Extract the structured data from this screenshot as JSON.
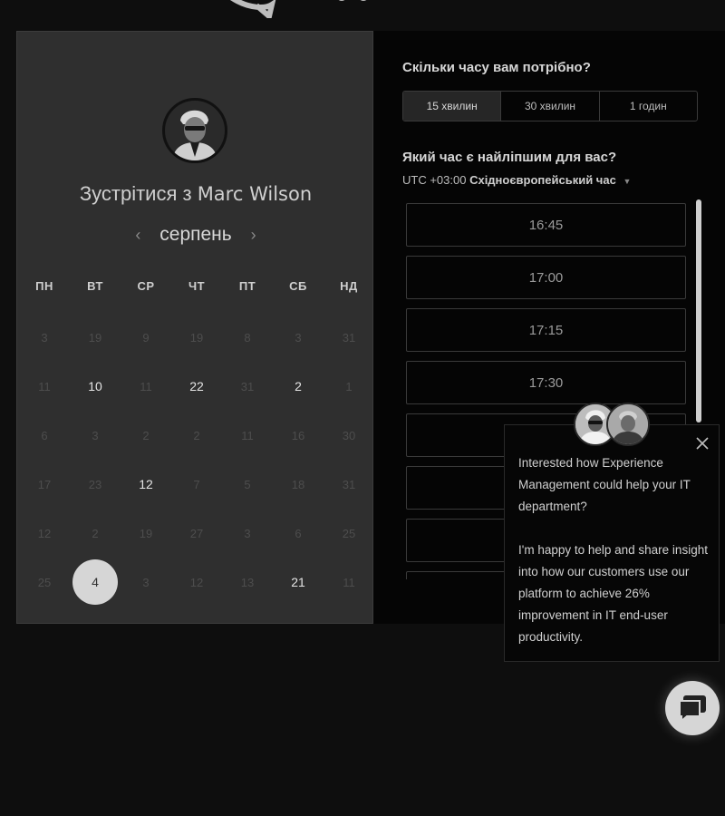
{
  "booking": {
    "meet_prefix": "Зустрітися з",
    "host_name": "Marc Wilson",
    "month": "серпень",
    "prev_arrow": "‹",
    "next_arrow": "›",
    "weekdays": [
      "ПН",
      "ВТ",
      "СР",
      "ЧТ",
      "ПТ",
      "СБ",
      "НД"
    ],
    "calendar": [
      [
        {
          "d": "3",
          "on": false
        },
        {
          "d": "19",
          "on": false
        },
        {
          "d": "9",
          "on": false
        },
        {
          "d": "19",
          "on": false
        },
        {
          "d": "8",
          "on": false
        },
        {
          "d": "3",
          "on": false
        },
        {
          "d": "31",
          "on": false
        }
      ],
      [
        {
          "d": "11",
          "on": false
        },
        {
          "d": "10",
          "on": true
        },
        {
          "d": "11",
          "on": false
        },
        {
          "d": "22",
          "on": true
        },
        {
          "d": "31",
          "on": false
        },
        {
          "d": "2",
          "on": true
        },
        {
          "d": "1",
          "on": false
        }
      ],
      [
        {
          "d": "6",
          "on": false
        },
        {
          "d": "3",
          "on": false
        },
        {
          "d": "2",
          "on": false
        },
        {
          "d": "2",
          "on": false
        },
        {
          "d": "11",
          "on": false
        },
        {
          "d": "16",
          "on": false
        },
        {
          "d": "30",
          "on": false
        }
      ],
      [
        {
          "d": "17",
          "on": false
        },
        {
          "d": "23",
          "on": false
        },
        {
          "d": "12",
          "on": true
        },
        {
          "d": "7",
          "on": false
        },
        {
          "d": "5",
          "on": false
        },
        {
          "d": "18",
          "on": false
        },
        {
          "d": "31",
          "on": false
        }
      ],
      [
        {
          "d": "12",
          "on": false
        },
        {
          "d": "2",
          "on": false
        },
        {
          "d": "19",
          "on": false
        },
        {
          "d": "27",
          "on": false
        },
        {
          "d": "3",
          "on": false
        },
        {
          "d": "6",
          "on": false
        },
        {
          "d": "25",
          "on": false
        }
      ],
      [
        {
          "d": "25",
          "on": false
        },
        {
          "d": "4",
          "on": true,
          "selected": true
        },
        {
          "d": "3",
          "on": false
        },
        {
          "d": "12",
          "on": false
        },
        {
          "d": "13",
          "on": false
        },
        {
          "d": "21",
          "on": true
        },
        {
          "d": "11",
          "on": false
        }
      ]
    ]
  },
  "scheduler": {
    "duration_question": "Скільки часу вам потрібно?",
    "durations": [
      "15 хвилин",
      "30 хвилин",
      "1 годин"
    ],
    "selected_duration": "15 хвилин",
    "time_question": "Який час є найліпшим для вас?",
    "timezone_offset": "UTC +03:00",
    "timezone_name": "Східноєвропейський час",
    "time_slots": [
      "16:45",
      "17:00",
      "17:15",
      "17:30",
      "",
      "",
      "",
      ""
    ]
  },
  "popup": {
    "paragraph1": "Interested how Experience Management could help your IT department?",
    "paragraph2": "I'm happy to help and share insight into how our customers use our platform to achieve 26% improvement in IT end-user productivity."
  },
  "colors": {
    "background": "#0e0e0e",
    "left_card": "#2f2f2f",
    "right_panel": "#050505",
    "selected_day": "#d6d6d6",
    "chat_button": "#d6d6d6"
  },
  "icons": {
    "close": "close-icon",
    "chat": "chat-icon",
    "caret": "caret-down-icon"
  }
}
